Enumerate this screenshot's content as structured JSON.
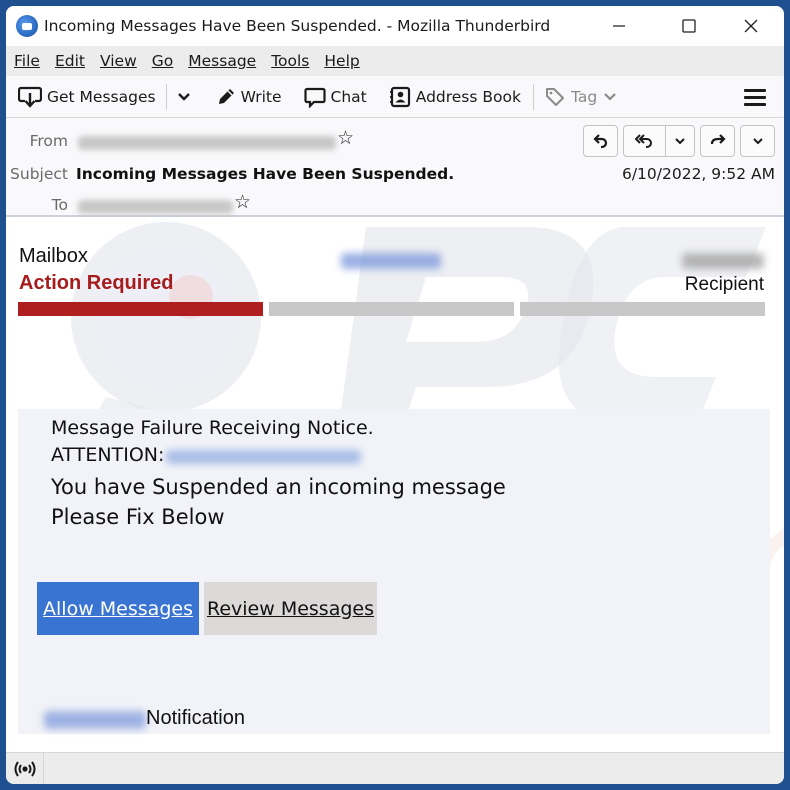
{
  "window": {
    "title": "Incoming Messages Have Been Suspended. - Mozilla Thunderbird",
    "app_icon": "thunderbird-logo-icon",
    "controls": {
      "minimize": "—",
      "maximize": "☐",
      "close": "✕"
    }
  },
  "menubar": {
    "items": [
      {
        "label": "File",
        "accesskey": "F"
      },
      {
        "label": "Edit",
        "accesskey": "E"
      },
      {
        "label": "View",
        "accesskey": "V"
      },
      {
        "label": "Go",
        "accesskey": "G"
      },
      {
        "label": "Message",
        "accesskey": "M"
      },
      {
        "label": "Tools",
        "accesskey": "T"
      },
      {
        "label": "Help",
        "accesskey": "H"
      }
    ]
  },
  "toolbar": {
    "get_messages": "Get Messages",
    "write": "Write",
    "chat": "Chat",
    "address_book": "Address Book",
    "tag": "Tag"
  },
  "header": {
    "from_label": "From",
    "subject_label": "Subject",
    "to_label": "To",
    "subject": "Incoming Messages Have Been Suspended.",
    "date": "6/10/2022, 9:52 AM",
    "from_value_redacted": true,
    "to_value_redacted": true
  },
  "email": {
    "mailbox_title": "Mailbox",
    "action_required": "Action Required",
    "recipient_label": "Recipient",
    "progress": {
      "steps": 3,
      "completed": 1,
      "active_color": "#b01f1f",
      "inactive_color": "#c8c8c8"
    },
    "notice_line1": "Message Failure Receiving Notice.",
    "attention_label": "ATTENTION:",
    "notice_line3": "You have Suspended an incoming message",
    "notice_line4": "Please Fix Below",
    "allow_button": "Allow Messages",
    "review_button": "Review Messages",
    "footer_suffix": "Notification",
    "colors": {
      "allow_button_bg": "#3a74d3",
      "review_button_bg": "#dcd9d9",
      "action_required": "#a61c1c"
    }
  },
  "statusbar": {
    "icon": "activity-broadcast-icon"
  }
}
